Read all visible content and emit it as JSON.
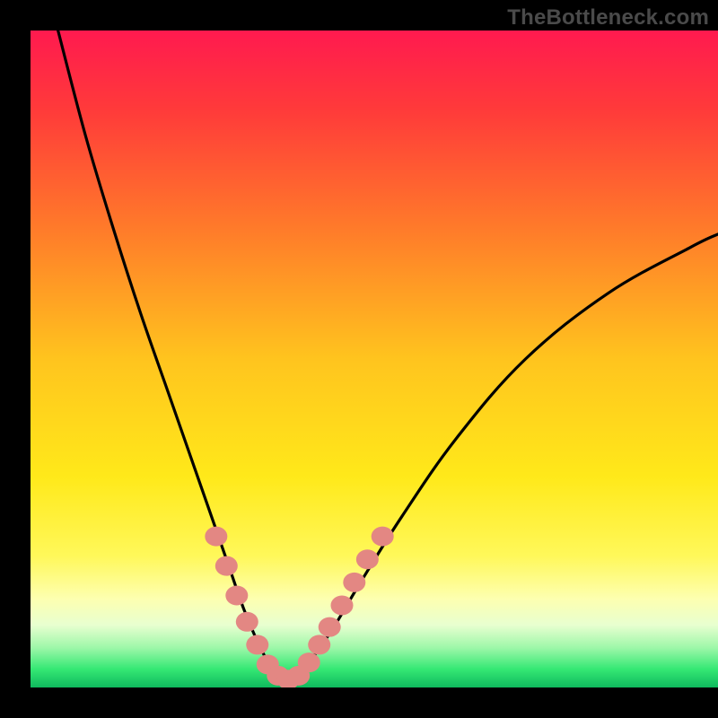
{
  "watermark": "TheBottleneck.com",
  "colors": {
    "bg_black": "#000000",
    "curve": "#000000",
    "marker_fill": "#e38783",
    "marker_stroke": "#b85c58",
    "gradient_stops": [
      {
        "offset": 0.0,
        "color": "#ff1a4f"
      },
      {
        "offset": 0.12,
        "color": "#ff3a3a"
      },
      {
        "offset": 0.3,
        "color": "#ff7a2a"
      },
      {
        "offset": 0.5,
        "color": "#ffc41e"
      },
      {
        "offset": 0.68,
        "color": "#ffe91a"
      },
      {
        "offset": 0.8,
        "color": "#fff85a"
      },
      {
        "offset": 0.865,
        "color": "#fdffb0"
      },
      {
        "offset": 0.905,
        "color": "#e8ffd0"
      },
      {
        "offset": 0.94,
        "color": "#9cf7a8"
      },
      {
        "offset": 0.972,
        "color": "#35e874"
      },
      {
        "offset": 1.0,
        "color": "#0fb95d"
      }
    ]
  },
  "chart_data": {
    "type": "line",
    "title": "",
    "xlabel": "",
    "ylabel": "",
    "xlim": [
      0,
      100
    ],
    "ylim": [
      0,
      100
    ],
    "grid": false,
    "legend": false,
    "series": [
      {
        "name": "bottleneck-curve",
        "x": [
          4,
          8,
          12,
          16,
          20,
          24,
          27,
          29,
          31,
          33,
          34.5,
          36,
          37.5,
          39,
          41,
          44,
          48,
          54,
          62,
          72,
          84,
          96,
          100
        ],
        "y": [
          100,
          84,
          70,
          57,
          45,
          33,
          24,
          18,
          12,
          7,
          4,
          2,
          1.2,
          2,
          4.5,
          9,
          16,
          26,
          38,
          50,
          60,
          67,
          69
        ]
      }
    ],
    "markers": {
      "name": "highlighted-points",
      "x": [
        27.0,
        28.5,
        30.0,
        31.5,
        33.0,
        34.5,
        36.0,
        37.5,
        39.0,
        40.5,
        42.0,
        43.5,
        45.3,
        47.1,
        49.0,
        51.2
      ],
      "y": [
        23.0,
        18.5,
        14.0,
        10.0,
        6.5,
        3.5,
        1.8,
        1.2,
        1.8,
        3.8,
        6.5,
        9.2,
        12.5,
        16.0,
        19.5,
        23.0
      ]
    }
  }
}
